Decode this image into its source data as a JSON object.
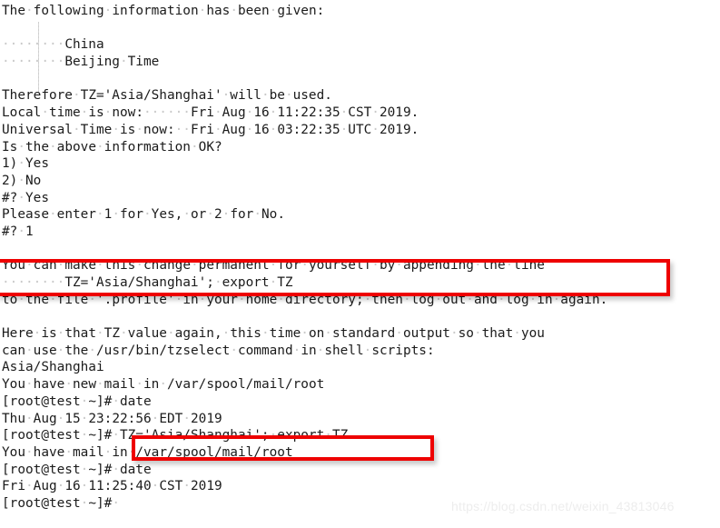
{
  "app": {
    "kind": "terminal-session",
    "background_color": "#ffffff",
    "text_color": "#1b1b1b",
    "whitespace_dot_color": "#c9c9c9",
    "annotation_color": "#ee0000"
  },
  "terminal": {
    "lines": [
      {
        "id": "l01",
        "text": "The following information has been given:"
      },
      {
        "id": "l02",
        "text": ""
      },
      {
        "id": "l03",
        "text": "        China"
      },
      {
        "id": "l04",
        "text": "        Beijing Time"
      },
      {
        "id": "l05",
        "text": ""
      },
      {
        "id": "l06",
        "text": "Therefore TZ='Asia/Shanghai' will be used."
      },
      {
        "id": "l07",
        "text": "Local time is now:      Fri Aug 16 11:22:35 CST 2019."
      },
      {
        "id": "l08",
        "text": "Universal Time is now:  Fri Aug 16 03:22:35 UTC 2019."
      },
      {
        "id": "l09",
        "text": "Is the above information OK?"
      },
      {
        "id": "l10",
        "text": "1) Yes"
      },
      {
        "id": "l11",
        "text": "2) No"
      },
      {
        "id": "l12",
        "text": "#? Yes"
      },
      {
        "id": "l13",
        "text": "Please enter 1 for Yes, or 2 for No."
      },
      {
        "id": "l14",
        "text": "#? 1"
      },
      {
        "id": "l15",
        "text": ""
      },
      {
        "id": "l16",
        "text": "You can make this change permanent for yourself by appending the line"
      },
      {
        "id": "l17",
        "text": "        TZ='Asia/Shanghai'; export TZ"
      },
      {
        "id": "l18",
        "text": "to the file '.profile' in your home directory; then log out and log in again."
      },
      {
        "id": "l19",
        "text": ""
      },
      {
        "id": "l20",
        "text": "Here is that TZ value again, this time on standard output so that you"
      },
      {
        "id": "l21",
        "text": "can use the /usr/bin/tzselect command in shell scripts:"
      },
      {
        "id": "l22",
        "text": "Asia/Shanghai"
      },
      {
        "id": "l23",
        "text": "You have new mail in /var/spool/mail/root"
      },
      {
        "id": "l24",
        "text": "[root@test ~]# date"
      },
      {
        "id": "l25",
        "text": "Thu Aug 15 23:22:56 EDT 2019"
      },
      {
        "id": "l26",
        "text": "[root@test ~]# TZ='Asia/Shanghai'; export TZ"
      },
      {
        "id": "l27",
        "text": "You have mail in /var/spool/mail/root"
      },
      {
        "id": "l28",
        "text": "[root@test ~]# date"
      },
      {
        "id": "l29",
        "text": "Fri Aug 16 11:25:40 CST 2019"
      },
      {
        "id": "l30",
        "text": "[root@test ~]# "
      }
    ]
  },
  "annotations": {
    "box_export_line_label": "",
    "box_command_label": ""
  },
  "watermark": {
    "text": "https://blog.csdn.net/weixin_43813046"
  }
}
